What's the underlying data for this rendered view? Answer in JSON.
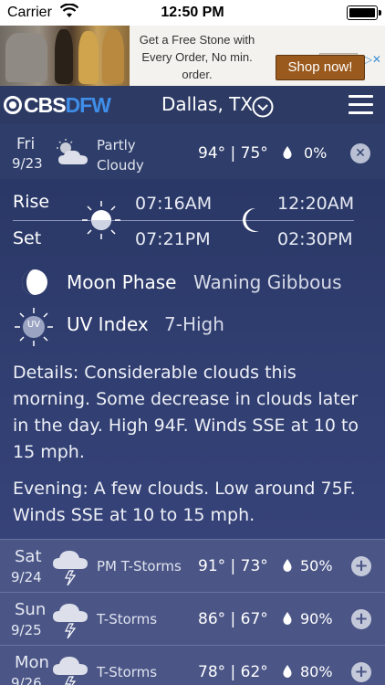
{
  "status_bar": {
    "carrier": "Carrier",
    "time": "12:50 PM"
  },
  "ad": {
    "headline": "Get a Free Stone with Every Order, No min. order.",
    "cta": "Shop now!",
    "choices_label": "▷✕"
  },
  "header": {
    "brand_cbs": "CBS",
    "brand_dfw": "DFW",
    "city": "Dallas, TX"
  },
  "today": {
    "day": "Fri",
    "date": "9/23",
    "condition_line1": "Partly",
    "condition_line2": "Cloudy",
    "temps": "94° | 75°",
    "precip": "0%",
    "condition_icon": "partly-cloudy-icon"
  },
  "astro": {
    "rise_label": "Rise",
    "set_label": "Set",
    "sunrise": "07:16AM",
    "sunset": "07:21PM",
    "moonrise": "12:20AM",
    "moonset": "02:30PM"
  },
  "moon_phase": {
    "label": "Moon Phase",
    "value": "Waning Gibbous"
  },
  "uv": {
    "badge": "UV",
    "label": "UV Index",
    "value": "7-High"
  },
  "details": "Details: Considerable clouds this morning. Some decrease in clouds later in the day. High 94F. Winds SSE at 10 to 15 mph.",
  "evening": "Evening: A few clouds. Low around 75F. Winds SSE at 10 to 15 mph.",
  "forecast": [
    {
      "day": "Sat",
      "date": "9/24",
      "condition": "PM T-Storms",
      "temps": "91° | 73°",
      "precip": "50%",
      "icon": "thunderstorm-icon"
    },
    {
      "day": "Sun",
      "date": "9/25",
      "condition": "T-Storms",
      "temps": "86° | 67°",
      "precip": "90%",
      "icon": "thunderstorm-icon"
    },
    {
      "day": "Mon",
      "date": "9/26",
      "condition": "T-Storms",
      "temps": "78° | 62°",
      "precip": "80%",
      "icon": "thunderstorm-icon"
    }
  ],
  "colors": {
    "accent": "#3f8ee8",
    "background": "#2f3f6c",
    "forecast_row": "#4b5687",
    "ad_cta": "#9b5a1d"
  }
}
